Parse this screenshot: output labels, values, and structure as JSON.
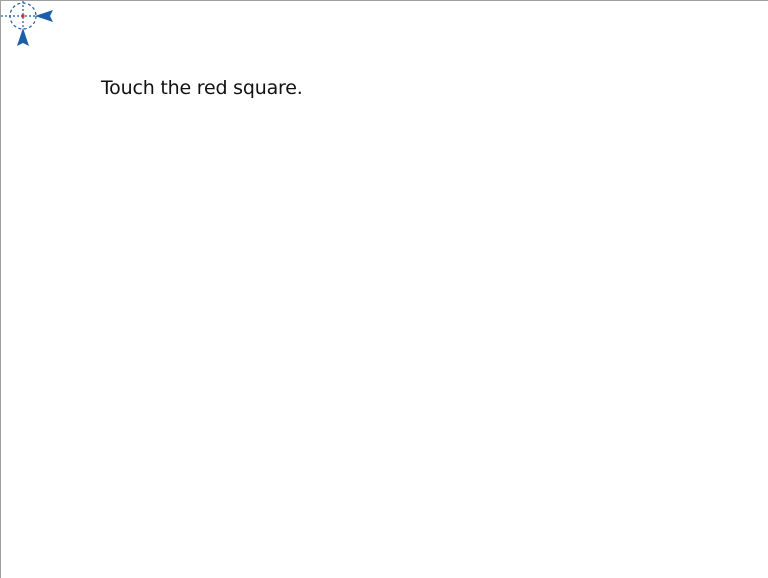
{
  "instruction": {
    "text": "Touch the red square."
  },
  "icons": {
    "calibration_target": "calibration-crosshair-icon"
  },
  "colors": {
    "background": "#ffffff",
    "text": "#111111",
    "crosshair_blue": "#1a5fa8",
    "crosshair_center": "#e0281e",
    "frame_border": "#a0a0a0"
  }
}
